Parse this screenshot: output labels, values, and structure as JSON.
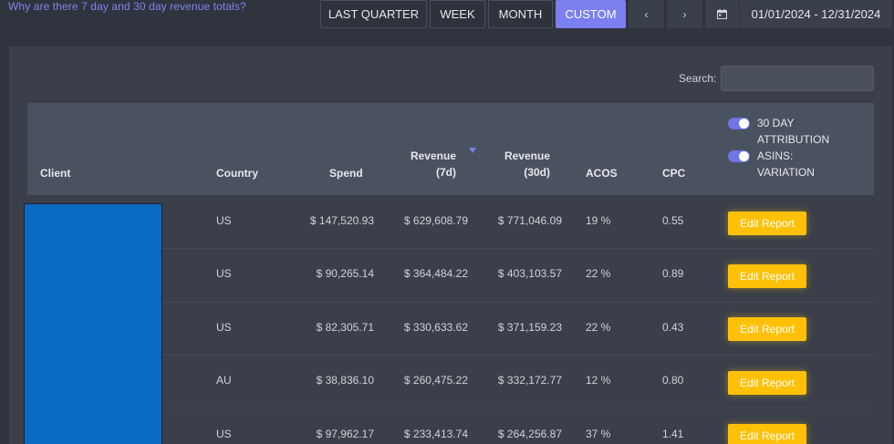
{
  "help_link": "Why are there 7 day and 30 day revenue totals?",
  "range_buttons": [
    "LAST QUARTER",
    "WEEK",
    "MONTH",
    "CUSTOM"
  ],
  "active_range": "CUSTOM",
  "nav": {
    "prev": "‹",
    "next": "›"
  },
  "date_range": "01/01/2024 - 12/31/2024",
  "search": {
    "label": "Search:",
    "value": ""
  },
  "table": {
    "headers": {
      "client": "Client",
      "country": "Country",
      "spend": "Spend",
      "revenue7_line1": "Revenue",
      "revenue7_line2": "(7d)",
      "revenue30_line1": "Revenue",
      "revenue30_line2": "(30d)",
      "acos": "ACOS",
      "cpc": "CPC"
    },
    "toggles": [
      {
        "line1": "30 DAY",
        "line2": "ATTRIBUTION",
        "on": true
      },
      {
        "line1": "ASINS:",
        "line2": "VARIATION",
        "on": true
      }
    ],
    "rows": [
      {
        "country": "US",
        "spend": "$ 147,520.93",
        "revenue7": "$ 629,608.79",
        "revenue30": "$ 771,046.09",
        "acos": "19 %",
        "cpc": "0.55",
        "action": "Edit Report"
      },
      {
        "country": "US",
        "spend": "$ 90,265.14",
        "revenue7": "$ 364,484.22",
        "revenue30": "$ 403,103.57",
        "acos": "22 %",
        "cpc": "0.89",
        "action": "Edit Report"
      },
      {
        "country": "US",
        "spend": "$ 82,305.71",
        "revenue7": "$ 330,633.62",
        "revenue30": "$ 371,159.23",
        "acos": "22 %",
        "cpc": "0.43",
        "action": "Edit Report"
      },
      {
        "country": "AU",
        "spend": "$ 38,836.10",
        "revenue7": "$ 260,475.22",
        "revenue30": "$ 332,172.77",
        "acos": "12 %",
        "cpc": "0.80",
        "action": "Edit Report"
      },
      {
        "country": "US",
        "spend": "$ 97,962.17",
        "revenue7": "$ 233,413.74",
        "revenue30": "$ 264,256.87",
        "acos": "37 %",
        "cpc": "1.41",
        "action": "Edit Report"
      }
    ]
  },
  "colors": {
    "accent": "#7b7ff0",
    "edit_button": "#ffc107",
    "client_redaction": "#0a6bc2"
  }
}
